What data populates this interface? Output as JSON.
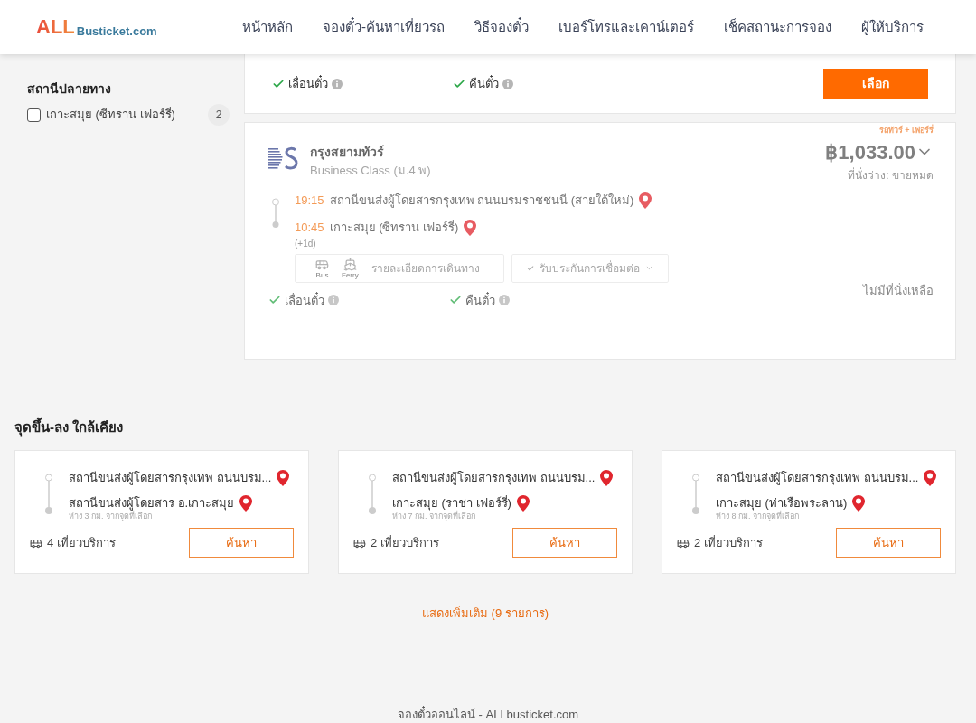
{
  "header": {
    "logo": {
      "accent": "ALL",
      "rest": "Busticket.com"
    },
    "nav": [
      "หน้าหลัก",
      "จองตั๋ว-ค้นหาเที่ยวรถ",
      "วิธีจองตั๋ว",
      "เบอร์โทรและเคาน์เตอร์",
      "เช็คสถานะการจอง",
      "ผู้ให้บริการ"
    ]
  },
  "sidebar": {
    "title": "สถานีปลายทาง",
    "options": [
      {
        "label": "เกาะสมุย (ซีทราน เฟอร์รี่)",
        "count": "2",
        "checked": false
      }
    ]
  },
  "trips": [
    {
      "kind": "partial",
      "available": true,
      "features": [
        {
          "label": "เลื่อนตั๋ว",
          "allowed": true
        },
        {
          "label": "คืนตั๋ว",
          "allowed": true
        }
      ],
      "select_button": "เลือก"
    },
    {
      "kind": "full",
      "available": false,
      "tag": "รถทัวร์ + เฟอร์รี่",
      "operator": "กรุงสยามทัวร์",
      "class": "Business Class (ม.4 พ)",
      "price": "฿1,033.00",
      "seats": "ที่นั่งว่าง: ขายหมด",
      "departure": {
        "time": "19:15",
        "station": "สถานีขนส่งผู้โดยสารกรุงเทพ ถนนบรมราชชนนี (สายใต้ใหม่)"
      },
      "arrival": {
        "time": "10:45",
        "station": "เกาะสมุย (ซีทราน เฟอร์รี่)",
        "day_offset": "(+1d)"
      },
      "modes": [
        {
          "kind": "bus",
          "label": "Bus"
        },
        {
          "kind": "ferry",
          "label": "Ferry"
        }
      ],
      "details_button": "รายละเอียดการเดินทาง",
      "guarantee_button": "รับประกันการเชื่อมต่อ",
      "features": [
        {
          "label": "เลื่อนตั๋ว",
          "allowed": true
        },
        {
          "label": "คืนตั๋ว",
          "allowed": true
        }
      ],
      "status": "ไม่มีที่นั่งเหลือ"
    }
  ],
  "nearby": {
    "title": "จุดขึ้น-ลง ใกล้เคียง",
    "cards": [
      {
        "from": "สถานีขนส่งผู้โดยสารกรุงเทพ ถนนบรม...",
        "to": "สถานีขนส่งผู้โดยสาร อ.เกาะสมุย",
        "distance": "ห่าง 3 กม. จากจุดที่เลือก",
        "trips": "4 เที่ยวบริการ",
        "button": "ค้นหา"
      },
      {
        "from": "สถานีขนส่งผู้โดยสารกรุงเทพ ถนนบรม...",
        "to": "เกาะสมุย (ราชา เฟอร์รี่)",
        "distance": "ห่าง 7 กม. จากจุดที่เลือก",
        "trips": "2 เที่ยวบริการ",
        "button": "ค้นหา"
      },
      {
        "from": "สถานีขนส่งผู้โดยสารกรุงเทพ ถนนบรม...",
        "to": "เกาะสมุย (ท่าเรือพระลาน)",
        "distance": "ห่าง 8 กม. จากจุดที่เลือก",
        "trips": "2 เที่ยวบริการ",
        "button": "ค้นหา"
      }
    ],
    "more_link": "แสดงเพิ่มเติม (9 รายการ)"
  },
  "footer": "จองตั๋วออนไลน์ - ALLbusticket.com"
}
